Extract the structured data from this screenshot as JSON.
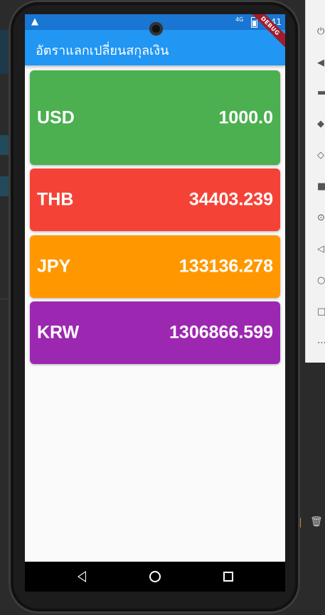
{
  "app": {
    "title": "อัตราแลกเปลี่ยนสกุลเงิน",
    "debug_banner": "DEBUG"
  },
  "status_bar": {
    "time": "4:41",
    "network": "4G",
    "icons": [
      "warning-icon",
      "signal-icon",
      "battery-icon"
    ]
  },
  "currencies": [
    {
      "code": "USD",
      "amount": "1000.0",
      "color": "#4caf50"
    },
    {
      "code": "THB",
      "amount": "34403.239",
      "color": "#f44336"
    },
    {
      "code": "JPY",
      "amount": "133136.278",
      "color": "#ff9800"
    },
    {
      "code": "KRW",
      "amount": "1306866.599",
      "color": "#9c27b0"
    }
  ],
  "nav_bar": {
    "buttons": [
      "back-icon",
      "home-icon",
      "recents-icon"
    ]
  },
  "colors": {
    "app_bar": "#2196f3",
    "status_bar": "#1976d2",
    "background": "#fafafa"
  }
}
